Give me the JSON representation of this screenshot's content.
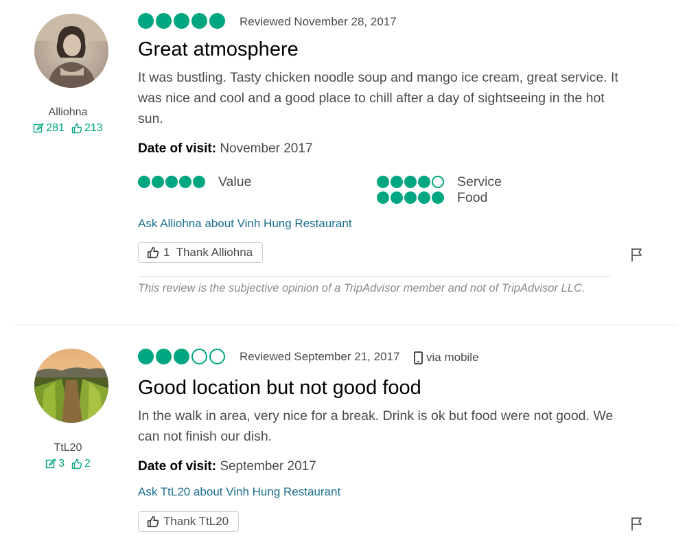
{
  "reviews": [
    {
      "username": "Alliohna",
      "contributions": "281",
      "helpful_votes": "213",
      "rating": 5,
      "reviewed_date": "Reviewed November 28, 2017",
      "title": "Great atmosphere",
      "body": "It was bustling. Tasty chicken noodle soup and mango ice cream, great service. It was nice and cool and a good place to chill after a day of sightseeing in the hot sun.",
      "date_of_visit_label": "Date of visit:",
      "date_of_visit": "November 2017",
      "subratings": [
        {
          "label": "Value",
          "rating": 5
        },
        {
          "label": "Service",
          "rating": 4
        },
        {
          "label": "Food",
          "rating": 5
        }
      ],
      "ask_link": "Ask Alliohna about Vinh Hung Restaurant",
      "thank_label": "1  Thank Alliohna",
      "disclaimer": "This review is the subjective opinion of a TripAdvisor member and not of TripAdvisor LLC."
    },
    {
      "username": "TtL20",
      "contributions": "3",
      "helpful_votes": "2",
      "rating": 3,
      "reviewed_date": "Reviewed September 21, 2017",
      "via": "via mobile",
      "title": "Good location but not good food",
      "body": "In the walk in area, very nice for a break. Drink is ok but food were not good. We can not finish our dish.",
      "date_of_visit_label": "Date of visit:",
      "date_of_visit": "September 2017",
      "ask_link": "Ask TtL20 about Vinh Hung Restaurant",
      "thank_label": "Thank TtL20"
    }
  ],
  "colors": {
    "bubble": "#00a680",
    "link": "#1a6e8e",
    "text": "#4a4a4a"
  },
  "icons": {
    "contributions": "pencil-edit-icon",
    "helpful": "thumbs-up-icon",
    "report": "flag-icon",
    "mobile": "mobile-phone-icon"
  }
}
